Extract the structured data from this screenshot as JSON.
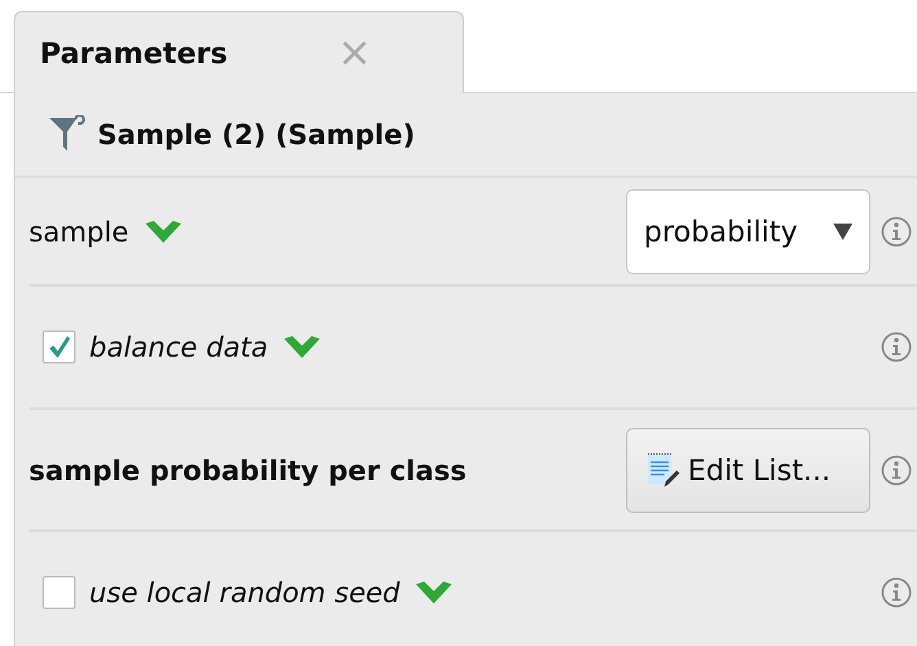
{
  "tab": {
    "label": "Parameters",
    "close": "×"
  },
  "operator": {
    "title": "Sample (2) (Sample)"
  },
  "parameters": [
    {
      "kind": "dropdown",
      "label": "sample",
      "chevron": true,
      "value": "probability"
    },
    {
      "kind": "checkbox",
      "label": "balance data",
      "chevron": true,
      "checked": true
    },
    {
      "kind": "list",
      "label": "sample probability per class",
      "chevron": false,
      "button": "Edit List..."
    },
    {
      "kind": "checkbox",
      "label": "use local random seed",
      "chevron": true,
      "checked": false
    }
  ]
}
